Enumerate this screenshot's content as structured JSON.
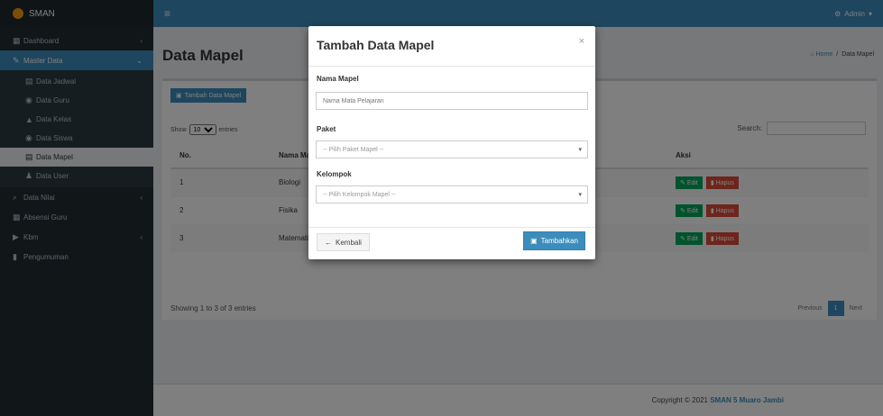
{
  "brand": {
    "name": "SMAN"
  },
  "sidebar": {
    "items": [
      {
        "label": "Dashboard",
        "icon": "dashboard-icon",
        "glyph": "▦"
      },
      {
        "label": "Master Data",
        "icon": "edit-icon",
        "glyph": "✎"
      }
    ],
    "submenu": [
      {
        "label": "Data Jadwal",
        "icon": "table-icon",
        "glyph": "▤"
      },
      {
        "label": "Data Guru",
        "icon": "users-icon",
        "glyph": "◉"
      },
      {
        "label": "Data Kelas",
        "icon": "building-icon",
        "glyph": "▲"
      },
      {
        "label": "Data Siswa",
        "icon": "student-icon",
        "glyph": "◉"
      },
      {
        "label": "Data Mapel",
        "icon": "book-icon",
        "glyph": "▤"
      },
      {
        "label": "Data User",
        "icon": "user-icon",
        "glyph": "♟"
      }
    ],
    "items_after": [
      {
        "label": "Data Nilai",
        "icon": "search-icon",
        "glyph": "⌕"
      },
      {
        "label": "Absensi Guru",
        "icon": "calendar-icon",
        "glyph": "▦"
      },
      {
        "label": "Kbm",
        "icon": "chart-icon",
        "glyph": "▶"
      },
      {
        "label": "Pengumuman",
        "icon": "bookmark-icon",
        "glyph": "▮"
      }
    ]
  },
  "topbar": {
    "menu_icon": "≡",
    "user_label": "Admin"
  },
  "page": {
    "title": "Data Mapel",
    "breadcrumb": [
      "Home",
      "Data Mapel"
    ]
  },
  "box": {
    "add_button": "Tambah Data Mapel",
    "show_prefix": "Show",
    "show_value": "10",
    "show_suffix": "entries",
    "search_label": "Search:",
    "columns": [
      "No.",
      "Nama Mapel",
      "Aksi"
    ],
    "rows": [
      {
        "no": "1",
        "nama": "Biologi"
      },
      {
        "no": "2",
        "nama": "Fisika"
      },
      {
        "no": "3",
        "nama": "Matematika"
      }
    ],
    "edit_label": "Edit",
    "delete_label": "Hapus",
    "info": "Showing 1 to 3 of 3 entries",
    "pager": {
      "prev": "Previous",
      "current": "1",
      "next": "Next"
    }
  },
  "footer": {
    "text": "Copyright © 2021",
    "owner": "SMAN 5 Muaro Jambi"
  },
  "modal": {
    "title": "Tambah Data Mapel",
    "close": "×",
    "nama_label": "Nama Mapel",
    "nama_placeholder": "Nama Mata Pelajaran",
    "paket_label": "Paket",
    "paket_value": "-- Pilih Paket Mapel --",
    "kelompok_label": "Kelompok",
    "kelompok_value": "-- Pilih Kelompok Mapel --",
    "back_label": "Kembali",
    "save_label": "Tambahkan"
  },
  "colors": {
    "primary": "#3c8dbc",
    "sidebar": "#222d32",
    "success": "#00a65a",
    "danger": "#dd4b39"
  }
}
